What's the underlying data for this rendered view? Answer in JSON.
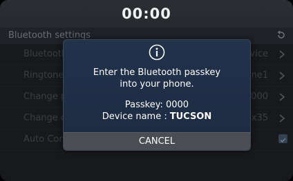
{
  "status_bar": {
    "time": "00:00"
  },
  "settings": {
    "header_title": "Bluetooth settings",
    "back_icon": "back-arrow-icon",
    "rows": [
      {
        "label": "Bluetooth",
        "value": "vice",
        "control": "chevron"
      },
      {
        "label": "Ringtone",
        "value": "ne1",
        "control": "chevron"
      },
      {
        "label": "Change p",
        "value": "000",
        "control": "chevron"
      },
      {
        "label": "Change d",
        "value": "x35",
        "control": "chevron"
      },
      {
        "label": "Auto Con",
        "value": "",
        "control": "checkbox",
        "checked": true
      }
    ]
  },
  "dialog": {
    "icon": "info-icon",
    "message_line1": "Enter the Bluetooth passkey",
    "message_line2": "into your phone.",
    "passkey_text": "Passkey: 0000",
    "device_label": "Device name :",
    "device_value": "TUCSON",
    "cancel_label": "CANCEL"
  },
  "colors": {
    "dialog_bg": "#1f2e45",
    "cancel_bg": "#4a4d52",
    "checkbox": "#5e7895"
  }
}
